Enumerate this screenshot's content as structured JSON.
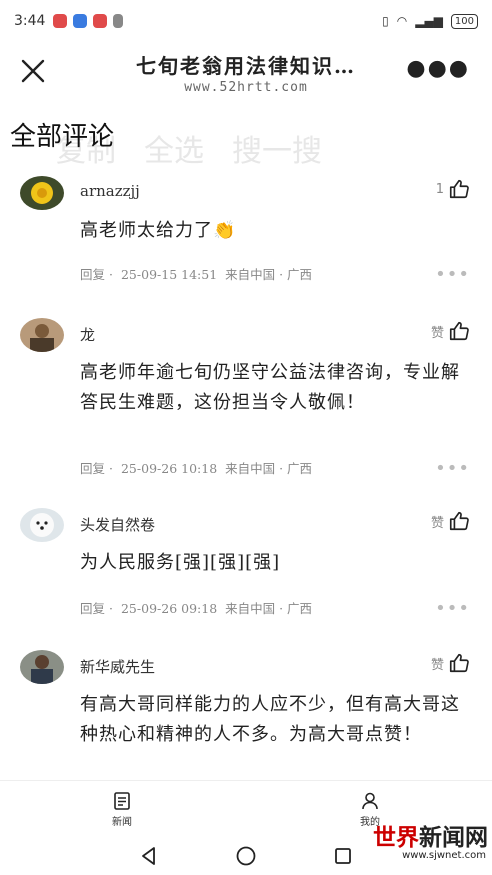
{
  "status_bar": {
    "time": "3:44",
    "battery": "100"
  },
  "header": {
    "title": "七旬老翁用法律知识…",
    "subtitle": "www.52hrtt.com",
    "close_icon": "close-icon",
    "more_icon": "more-dots-icon"
  },
  "section": {
    "title": "全部评论",
    "ghost_actions": [
      "复制",
      "全选",
      "搜一搜"
    ]
  },
  "comments": [
    {
      "username": "arnazzjj",
      "like_label": "1",
      "text": "高老师太给力了👏",
      "reply": "回复",
      "date": "25-09-15 14:51",
      "location": "来自中国 · 广西"
    },
    {
      "username": "龙",
      "like_label": "赞",
      "text": "高老师年逾七旬仍坚守公益法律咨询，专业解答民生难题，这份担当令人敬佩！",
      "reply": "回复",
      "date": "25-09-26 10:18",
      "location": "来自中国 · 广西"
    },
    {
      "username": "头发自然卷",
      "like_label": "赞",
      "text": "为人民服务[强][强][强]",
      "reply": "回复",
      "date": "25-09-26 09:18",
      "location": "来自中国 · 广西"
    },
    {
      "username": "新华威先生",
      "like_label": "赞",
      "text": "有高大哥同样能力的人应不少，但有高大哥这种热心和精神的人不多。为高大哥点赞！",
      "reply": "",
      "date": "",
      "location": ""
    }
  ],
  "tabs": [
    {
      "label": "新闻",
      "icon": "news-icon"
    },
    {
      "label": "我的",
      "icon": "profile-icon"
    }
  ],
  "watermark": {
    "brand_a": "世界",
    "brand_b": "新闻网",
    "url": "www.sjwnet.com"
  }
}
